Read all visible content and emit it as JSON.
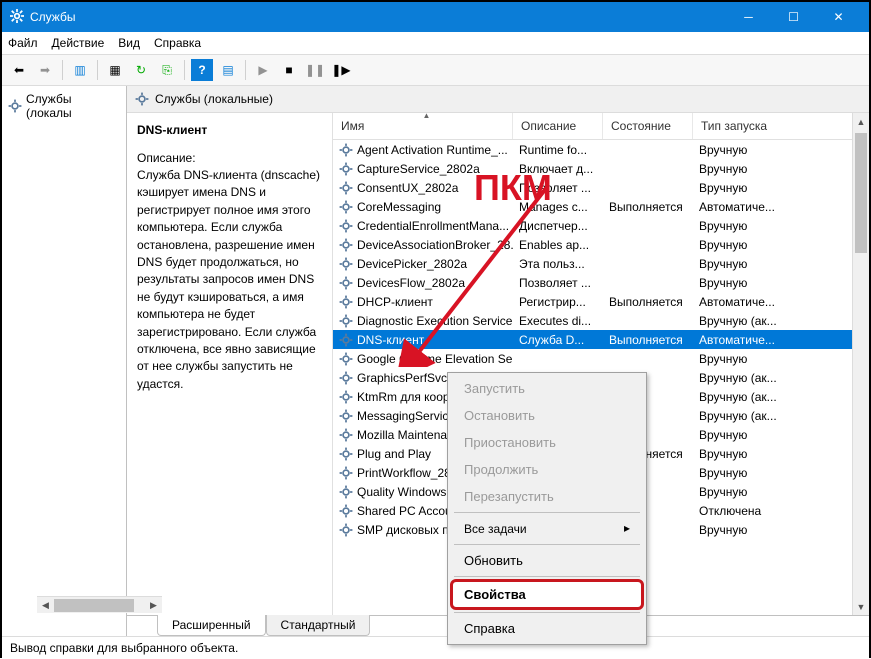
{
  "window": {
    "title": "Службы",
    "menu": {
      "file": "Файл",
      "action": "Действие",
      "view": "Вид",
      "help": "Справка"
    },
    "statusbar": "Вывод справки для выбранного объекта."
  },
  "sidebar": {
    "root": "Службы (локалы"
  },
  "content": {
    "header": "Службы (локальные)",
    "selected_service": "DNS-клиент",
    "desc_label": "Описание:",
    "desc_text": "Служба DNS-клиента (dnscache) кэширует имена DNS и регистрирует полное имя этого компьютера. Если служба остановлена, разрешение имен DNS будет продолжаться, но результаты запросов имен DNS не будут кэшироваться, а имя компьютера не будет зарегистрировано. Если служба отключена, все явно зависящие от нее службы запустить не удастся."
  },
  "columns": {
    "name": "Имя",
    "desc": "Описание",
    "state": "Состояние",
    "start": "Тип запуска"
  },
  "services": [
    {
      "name": "Agent Activation Runtime_...",
      "desc": "Runtime fo...",
      "state": "",
      "start": "Вручную"
    },
    {
      "name": "CaptureService_2802a",
      "desc": "Включает д...",
      "state": "",
      "start": "Вручную"
    },
    {
      "name": "ConsentUX_2802a",
      "desc": "Позволяет ...",
      "state": "",
      "start": "Вручную"
    },
    {
      "name": "CoreMessaging",
      "desc": "Manages c...",
      "state": "Выполняется",
      "start": "Автоматиче..."
    },
    {
      "name": "CredentialEnrollmentMana...",
      "desc": "Диспетчер...",
      "state": "",
      "start": "Вручную"
    },
    {
      "name": "DeviceAssociationBroker_28...",
      "desc": "Enables ap...",
      "state": "",
      "start": "Вручную"
    },
    {
      "name": "DevicePicker_2802a",
      "desc": "Эта польз...",
      "state": "",
      "start": "Вручную"
    },
    {
      "name": "DevicesFlow_2802a",
      "desc": "Позволяет ...",
      "state": "",
      "start": "Вручную"
    },
    {
      "name": "DHCP-клиент",
      "desc": "Регистрир...",
      "state": "Выполняется",
      "start": "Автоматиче..."
    },
    {
      "name": "Diagnostic Execution Service",
      "desc": "Executes di...",
      "state": "",
      "start": "Вручную (ак..."
    },
    {
      "name": "DNS-клиент",
      "desc": "Служба D...",
      "state": "Выполняется",
      "start": "Автоматиче..."
    },
    {
      "name": "Google Chrome Elevation Se...",
      "desc": "",
      "state": "",
      "start": "Вручную"
    },
    {
      "name": "GraphicsPerfSvc",
      "desc": "",
      "state": "",
      "start": "Вручную (ак..."
    },
    {
      "name": "KtmRm для координатора т...",
      "desc": "",
      "state": "",
      "start": "Вручную (ак..."
    },
    {
      "name": "MessagingService_2802a",
      "desc": "",
      "state": "",
      "start": "Вручную (ак..."
    },
    {
      "name": "Mozilla Maintenance Service",
      "desc": "",
      "state": "",
      "start": "Вручную"
    },
    {
      "name": "Plug and Play",
      "desc": "",
      "state": "Выполняется",
      "start": "Вручную"
    },
    {
      "name": "PrintWorkflow_2802a",
      "desc": "",
      "state": "",
      "start": "Вручную"
    },
    {
      "name": "Quality Windows Audio Vid...",
      "desc": "",
      "state": "",
      "start": "Вручную"
    },
    {
      "name": "Shared PC Account Manager",
      "desc": "",
      "state": "",
      "start": "Отключена"
    },
    {
      "name": "SMP дисковых пространств...",
      "desc": "",
      "state": "",
      "start": "Вручную"
    }
  ],
  "tabs": {
    "ext": "Расширенный",
    "std": "Стандартный"
  },
  "context": {
    "start": "Запустить",
    "stop": "Остановить",
    "pause": "Приостановить",
    "resume": "Продолжить",
    "restart": "Перезапустить",
    "alltasks": "Все задачи",
    "refresh": "Обновить",
    "properties": "Свойства",
    "help": "Справка"
  },
  "annotation": {
    "label": "ПКМ"
  }
}
